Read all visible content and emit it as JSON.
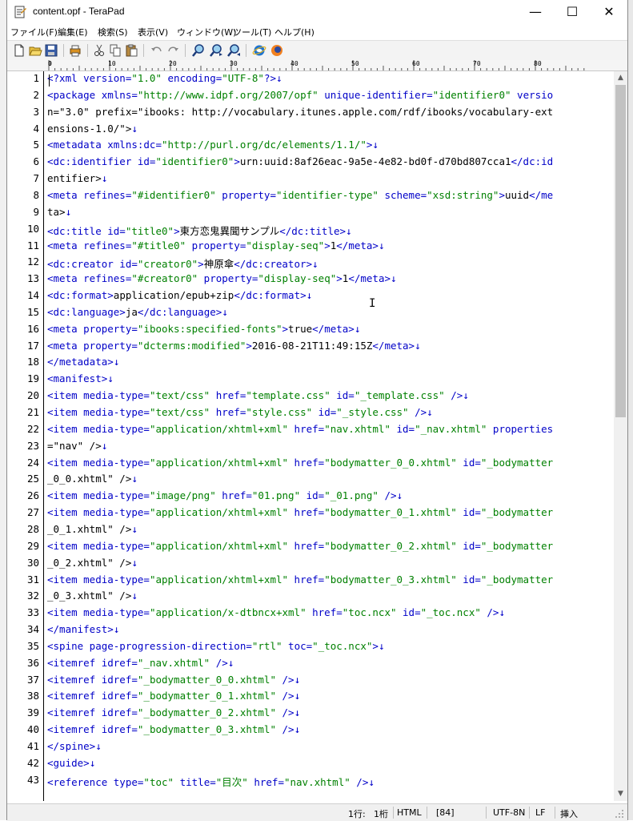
{
  "window": {
    "title": "content.opf - TeraPad",
    "minimize": "—",
    "maximize": "☐",
    "close": "✕"
  },
  "menu": [
    "ファイル(F)",
    "編集(E)",
    "検索(S)",
    "表示(V)",
    "ウィンドウ(W)",
    "ツール(T)",
    "ヘルプ(H)"
  ],
  "toolbar": {
    "icons": [
      "new-file-icon",
      "open-folder-icon",
      "save-icon",
      "print-icon",
      "cut-icon",
      "copy-icon",
      "paste-icon",
      "undo-icon",
      "redo-icon",
      "find-icon",
      "find-next-icon",
      "find-prev-icon",
      "browser-ie-icon",
      "browser-firefox-icon"
    ]
  },
  "ruler": {
    "labels": [
      "0",
      "10",
      "20",
      "30",
      "40",
      "50",
      "60",
      "70",
      "80"
    ]
  },
  "editor": {
    "line_numbers": [
      "1",
      "2",
      "3",
      "4",
      "5",
      "6",
      "7",
      "8",
      "9",
      "10",
      "11",
      "12",
      "13",
      "14",
      "15",
      "16",
      "17",
      "18",
      "19",
      "20",
      "21",
      "22",
      "23",
      "24",
      "25",
      "26",
      "27",
      "28",
      "29",
      "30",
      "31",
      "32",
      "33",
      "34",
      "35",
      "36",
      "37",
      "38",
      "39",
      "40",
      "41",
      "42",
      "43"
    ],
    "lines": [
      "<?xml version=\"1.0\" encoding=\"UTF-8\"?>↓",
      "<package xmlns=\"http://www.idpf.org/2007/opf\" unique-identifier=\"identifier0\" versio",
      "n=\"3.0\" prefix=\"ibooks: http://vocabulary.itunes.apple.com/rdf/ibooks/vocabulary-ext",
      "ensions-1.0/\">↓",
      "<metadata xmlns:dc=\"http://purl.org/dc/elements/1.1/\">↓",
      "<dc:identifier id=\"identifier0\">urn:uuid:8af26eac-9a5e-4e82-bd0f-d70bd807cca1</dc:id",
      "entifier>↓",
      "<meta refines=\"#identifier0\" property=\"identifier-type\" scheme=\"xsd:string\">uuid</me",
      "ta>↓",
      "<dc:title id=\"title0\">東方恋鬼異聞サンプル</dc:title>↓",
      "<meta refines=\"#title0\" property=\"display-seq\">1</meta>↓",
      "<dc:creator id=\"creator0\">神原傘</dc:creator>↓",
      "<meta refines=\"#creator0\" property=\"display-seq\">1</meta>↓",
      "<dc:format>application/epub+zip</dc:format>↓",
      "<dc:language>ja</dc:language>↓",
      "<meta property=\"ibooks:specified-fonts\">true</meta>↓",
      "<meta property=\"dcterms:modified\">2016-08-21T11:49:15Z</meta>↓",
      "</metadata>↓",
      "<manifest>↓",
      "<item media-type=\"text/css\" href=\"template.css\" id=\"_template.css\" />↓",
      "<item media-type=\"text/css\" href=\"style.css\" id=\"_style.css\" />↓",
      "<item media-type=\"application/xhtml+xml\" href=\"nav.xhtml\" id=\"_nav.xhtml\" properties",
      "=\"nav\" />↓",
      "<item media-type=\"application/xhtml+xml\" href=\"bodymatter_0_0.xhtml\" id=\"_bodymatter",
      "_0_0.xhtml\" />↓",
      "<item media-type=\"image/png\" href=\"01.png\" id=\"_01.png\" />↓",
      "<item media-type=\"application/xhtml+xml\" href=\"bodymatter_0_1.xhtml\" id=\"_bodymatter",
      "_0_1.xhtml\" />↓",
      "<item media-type=\"application/xhtml+xml\" href=\"bodymatter_0_2.xhtml\" id=\"_bodymatter",
      "_0_2.xhtml\" />↓",
      "<item media-type=\"application/xhtml+xml\" href=\"bodymatter_0_3.xhtml\" id=\"_bodymatter",
      "_0_3.xhtml\" />↓",
      "<item media-type=\"application/x-dtbncx+xml\" href=\"toc.ncx\" id=\"_toc.ncx\" />↓",
      "</manifest>↓",
      "<spine page-progression-direction=\"rtl\" toc=\"_toc.ncx\">↓",
      "<itemref idref=\"_nav.xhtml\" />↓",
      "<itemref idref=\"_bodymatter_0_0.xhtml\" />↓",
      "<itemref idref=\"_bodymatter_0_1.xhtml\" />↓",
      "<itemref idref=\"_bodymatter_0_2.xhtml\" />↓",
      "<itemref idref=\"_bodymatter_0_3.xhtml\" />↓",
      "</spine>↓",
      "<guide>↓",
      "<reference type=\"toc\" title=\"目次\" href=\"nav.xhtml\" />↓"
    ]
  },
  "statusbar": {
    "row": "1行:",
    "col": "1桁",
    "mode": "HTML",
    "code": "[84]",
    "encoding": "UTF-8N",
    "linebreak": "LF",
    "insert": "挿入"
  }
}
